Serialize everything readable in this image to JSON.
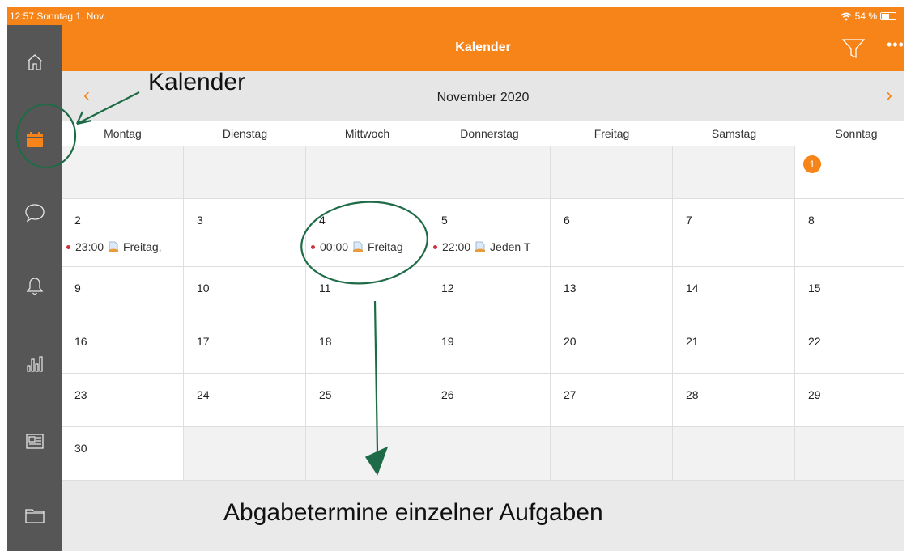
{
  "status": {
    "time_date": "12:57  Sonntag 1. Nov.",
    "battery": "54 %"
  },
  "nav": {
    "title": "Kalender"
  },
  "calendar": {
    "month": "November 2020",
    "weekdays": [
      "Montag",
      "Dienstag",
      "Mittwoch",
      "Donnerstag",
      "Freitag",
      "Samstag",
      "Sonntag"
    ],
    "today": "1",
    "days": {
      "d2": "2",
      "d3": "3",
      "d4": "4",
      "d5": "5",
      "d6": "6",
      "d7": "7",
      "d8": "8",
      "d9": "9",
      "d10": "10",
      "d11": "11",
      "d12": "12",
      "d13": "13",
      "d14": "14",
      "d15": "15",
      "d16": "16",
      "d17": "17",
      "d18": "18",
      "d19": "19",
      "d20": "20",
      "d21": "21",
      "d22": "22",
      "d23": "23",
      "d24": "24",
      "d25": "25",
      "d26": "26",
      "d27": "27",
      "d28": "28",
      "d29": "29",
      "d30": "30"
    },
    "events": {
      "e2": {
        "time": "23:00",
        "title": "Freitag,"
      },
      "e4": {
        "time": "00:00",
        "title": "Freitag"
      },
      "e5": {
        "time": "22:00",
        "title": "Jeden T"
      }
    }
  },
  "annotations": {
    "top": "Kalender",
    "bottom": "Abgabetermine einzelner Aufgaben"
  },
  "colors": {
    "accent": "#f78418",
    "sidebar": "#565656",
    "event_dot": "#d0303c",
    "annotation": "#1e6b47"
  },
  "icons": [
    "home-icon",
    "calendar-icon",
    "chat-icon",
    "bell-icon",
    "stats-icon",
    "news-icon",
    "folder-icon",
    "filter-icon",
    "more-icon",
    "chevron-left-icon",
    "chevron-right-icon",
    "wifi-icon",
    "battery-icon",
    "document-icon"
  ]
}
